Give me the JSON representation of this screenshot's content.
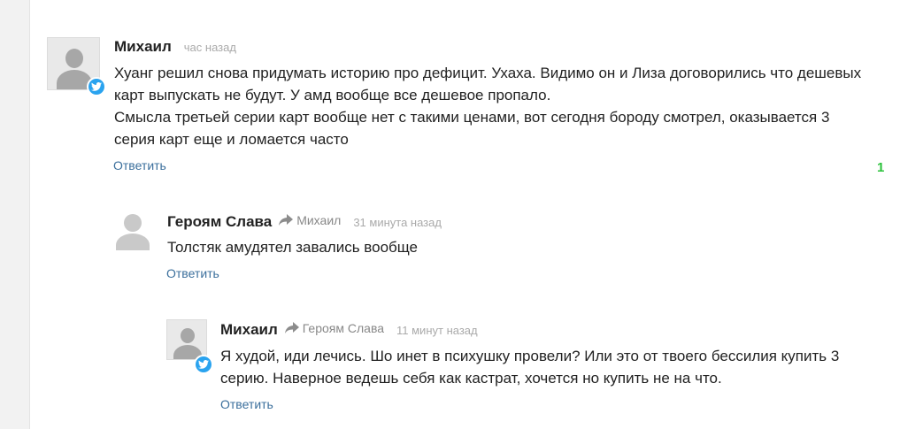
{
  "comments": [
    {
      "author": "Михаил",
      "reply_to": "",
      "time": "час назад",
      "lines": [
        "Хуанг решил снова придумать историю про дефицит. Ухаха. Видимо он и Лиза договорились что дешевых",
        "карт выпускать не будут. У амд вообще все дешевое пропало.",
        "Смысла третьей серии карт вообще нет с такими ценами, вот сегодня бороду смотрел, оказывается 3",
        "серия карт еще и ломается часто"
      ],
      "reply_label": "Ответить",
      "likes": "1",
      "badge": "twitter-icon"
    },
    {
      "author": "Героям Слава",
      "reply_to": "Михаил",
      "time": "31 минута назад",
      "lines": [
        "Толстяк амудятел завались вообще"
      ],
      "reply_label": "Ответить"
    },
    {
      "author": "Михаил",
      "reply_to": "Героям Слава",
      "time": "11 минут назад",
      "lines": [
        "Я худой, иди лечись. Шо инет в психушку провели? Или это от твоего бессилия купить 3",
        "серию. Наверное ведешь себя как кастрат, хочется но купить не на что."
      ],
      "reply_label": "Ответить",
      "badge": "twitter-icon"
    }
  ],
  "colors": {
    "link": "#3b6f9c",
    "likes": "#2bc23b",
    "twitter": "#2aa3ef"
  }
}
